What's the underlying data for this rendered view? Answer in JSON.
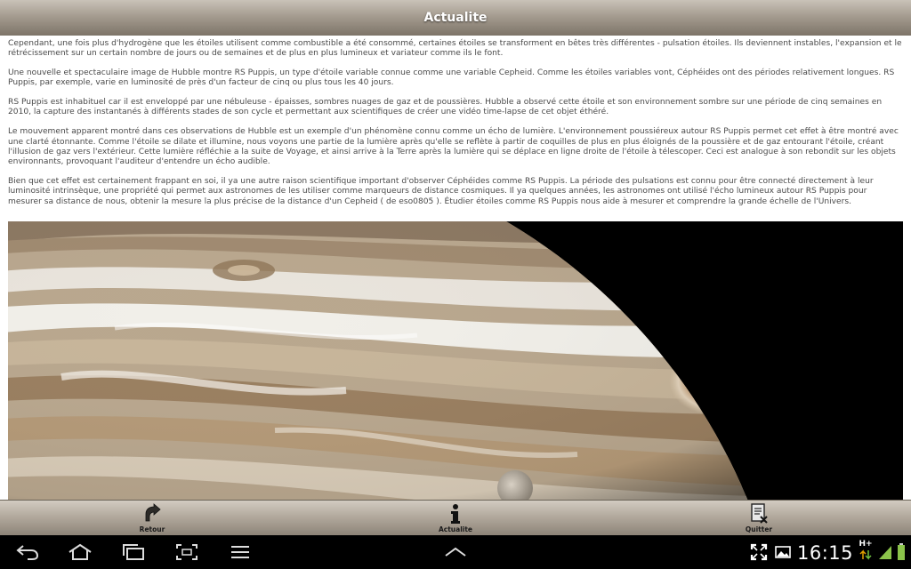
{
  "header": {
    "title": "Actualite"
  },
  "article": {
    "paragraphs": [
      "Cependant, une fois plus d'hydrogène que les étoiles utilisent comme combustible a été consommé, certaines étoiles se transforment en bêtes très différentes - pulsation étoiles. Ils deviennent instables, l'expansion et le rétrécissement sur un certain nombre de jours ou de semaines et de plus en plus lumineux et variateur comme ils le font.",
      "Une nouvelle et spectaculaire image de Hubble montre RS Puppis, un type d'étoile variable connue comme une variable Cepheid. Comme les étoiles variables vont, Céphéides ont des périodes relativement longues. RS Puppis, par exemple, varie en luminosité de près d'un facteur de cinq ou plus tous les 40 jours.",
      "RS Puppis est inhabituel car il est enveloppé par une nébuleuse - épaisses, sombres nuages de gaz et de poussières. Hubble a observé cette étoile et son environnement sombre sur une période de cinq semaines en 2010, la capture des instantanés à différents stades de son cycle et permettant aux scientifiques de créer une vidéo time-lapse de cet objet éthéré.",
      "Le mouvement apparent montré dans ces observations de Hubble est un exemple d'un phénomène connu comme un écho de lumière. L'environnement poussiéreux autour RS Puppis permet cet effet à être montré avec une clarté étonnante. Comme l'étoile se dilate et illumine, nous voyons une partie de la lumière après qu'elle se reflète à partir de coquilles de plus en plus éloignés de la poussière et de gaz entourant l'étoile, créant l'illusion de gaz vers l'extérieur. Cette lumière réfléchie a la suite de Voyage, et ainsi arrive à la Terre après la lumière qui se déplace en ligne droite de l'étoile à télescoper. Ceci est analogue à son rebondit sur les objets environnants, provoquant l'auditeur d'entendre un écho audible."
    ],
    "last_paragraph_before": "Bien que cet effet est certainement frappant en soi, il ya une autre raison scientifique important d'observer Céphéides comme RS Puppis. La période des pulsations est connu pour être connecté directement à leur luminosité intrinsèque, une propriété qui permet aux astronomes de les utiliser comme marqueurs de distance cosmiques. Il ya quelques années, les astronomes ont utilisé l'écho lumineux autour RS Puppis pour mesurer sa distance de nous, obtenir la mesure la plus précise de la distance d'un Cepheid (",
    "last_paragraph_link": " de eso0805 ",
    "last_paragraph_after": "). Étudier étoiles comme RS Puppis nous aide à mesurer et comprendre la grande échelle de l'Univers."
  },
  "toolbar": {
    "back_label": "Retour",
    "news_label": "Actualite",
    "quit_label": "Quitter"
  },
  "statusbar": {
    "clock": "16:15",
    "network": "H+"
  },
  "icons": {
    "back": "arrow-icon",
    "news": "info-icon",
    "quit": "document-close-icon"
  }
}
